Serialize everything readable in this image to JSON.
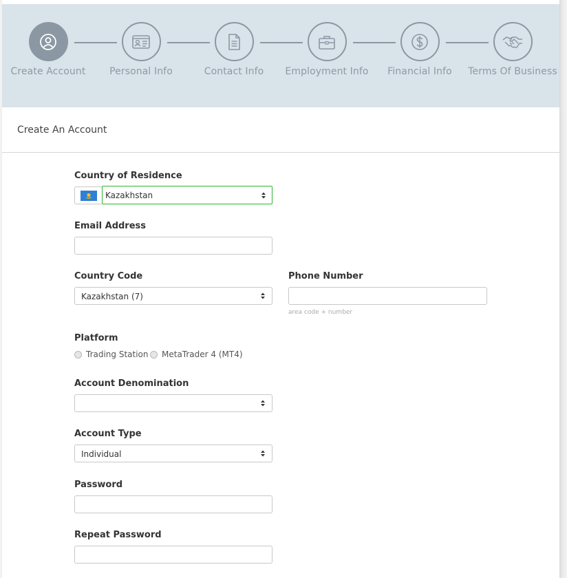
{
  "steps": [
    {
      "label": "Create Account",
      "icon": "user-circle-icon",
      "active": true
    },
    {
      "label": "Personal Info",
      "icon": "id-card-icon",
      "active": false
    },
    {
      "label": "Contact Info",
      "icon": "document-icon",
      "active": false
    },
    {
      "label": "Employment Info",
      "icon": "briefcase-icon",
      "active": false
    },
    {
      "label": "Financial Info",
      "icon": "dollar-icon",
      "active": false
    },
    {
      "label": "Terms Of Business",
      "icon": "handshake-icon",
      "active": false
    }
  ],
  "section": {
    "title": "Create An Account"
  },
  "form": {
    "country_label": "Country of Residence",
    "country_value": "Kazakhstan",
    "country_flag": "kazakhstan-flag",
    "email_label": "Email Address",
    "email_value": "",
    "country_code_label": "Country Code",
    "country_code_value": "Kazakhstan (7)",
    "phone_label": "Phone Number",
    "phone_value": "",
    "phone_hint": "area code + number",
    "platform_label": "Platform",
    "platform_options": [
      "Trading Station",
      "MetaTrader 4 (MT4)"
    ],
    "denomination_label": "Account Denomination",
    "denomination_value": "",
    "account_type_label": "Account Type",
    "account_type_value": "Individual",
    "password_label": "Password",
    "repeat_password_label": "Repeat Password"
  },
  "colors": {
    "stepper_bg": "#d8e3ea",
    "step_accent": "#8b98a3",
    "focus_border": "#2fb52f",
    "flag_blue": "#2f7fd4",
    "flag_gold": "#f2c21b"
  }
}
